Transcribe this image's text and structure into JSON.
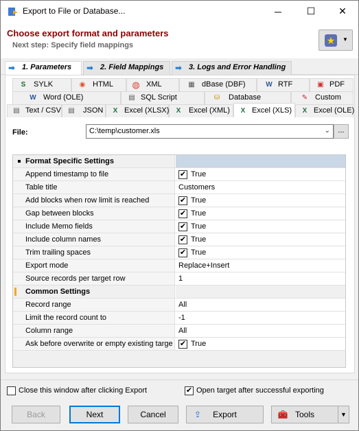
{
  "window": {
    "title": "Export to File or Database...",
    "minimize": "─",
    "maximize": "☐",
    "close": "✕"
  },
  "header": {
    "title": "Choose export format and parameters",
    "subtitle": "Next step: Specify field mappings"
  },
  "steps": [
    {
      "label": "1. Parameters",
      "active": true
    },
    {
      "label": "2. Field Mappings",
      "active": false
    },
    {
      "label": "3. Logs and Error Handling",
      "active": false
    }
  ],
  "format_tabs": {
    "row1": [
      {
        "label": "SYLK",
        "icon": "sylk-icon"
      },
      {
        "label": "HTML",
        "icon": "html-icon"
      },
      {
        "label": "XML",
        "icon": "xml-icon"
      },
      {
        "label": "dBase (DBF)",
        "icon": "dbf-icon"
      },
      {
        "label": "RTF",
        "icon": "rtf-icon"
      },
      {
        "label": "PDF",
        "icon": "pdf-icon"
      }
    ],
    "row2": [
      {
        "label": "Word (OLE)",
        "icon": "word-icon"
      },
      {
        "label": "SQL Script",
        "icon": "sql-icon"
      },
      {
        "label": "Database",
        "icon": "database-icon"
      },
      {
        "label": "Custom",
        "icon": "custom-icon"
      }
    ],
    "row3": [
      {
        "label": "Text / CSV",
        "icon": "text-icon"
      },
      {
        "label": "JSON",
        "icon": "json-icon"
      },
      {
        "label": "Excel (XLSX)",
        "icon": "excel-icon"
      },
      {
        "label": "Excel (XML)",
        "icon": "excel-icon"
      },
      {
        "label": "Excel (XLS)",
        "icon": "excel-icon",
        "active": true
      },
      {
        "label": "Excel (OLE)",
        "icon": "excel-icon"
      }
    ]
  },
  "file": {
    "label": "File:",
    "value": "C:\\temp\\customer.xls",
    "browse": "..."
  },
  "settings": {
    "section1": "Format Specific Settings",
    "rows1": [
      {
        "name": "Append timestamp to file",
        "value": "True",
        "checkbox": true
      },
      {
        "name": "Table title",
        "value": "Customers",
        "checkbox": false
      },
      {
        "name": "Add blocks when row limit is reached",
        "value": "True",
        "checkbox": true
      },
      {
        "name": "Gap between blocks",
        "value": "True",
        "checkbox": true
      },
      {
        "name": "Include Memo fields",
        "value": "True",
        "checkbox": true
      },
      {
        "name": "Include column names",
        "value": "True",
        "checkbox": true
      },
      {
        "name": "Trim trailing spaces",
        "value": "True",
        "checkbox": true
      },
      {
        "name": "Export mode",
        "value": "Replace+Insert",
        "checkbox": false
      },
      {
        "name": "Source records per target row",
        "value": "1",
        "checkbox": false
      }
    ],
    "section2": "Common Settings",
    "rows2": [
      {
        "name": "Record range",
        "value": "All",
        "checkbox": false
      },
      {
        "name": "Limit the record count to",
        "value": "-1",
        "checkbox": false
      },
      {
        "name": "Column range",
        "value": "All",
        "checkbox": false
      },
      {
        "name": "Ask before overwrite or empty existing targe",
        "value": "True",
        "checkbox": true
      }
    ]
  },
  "footer": {
    "close_after": "Close this window after clicking Export",
    "close_after_checked": false,
    "open_target": "Open target after successful exporting",
    "open_target_checked": true,
    "back": "Back",
    "next": "Next",
    "cancel": "Cancel",
    "export": "Export",
    "tools": "Tools"
  }
}
